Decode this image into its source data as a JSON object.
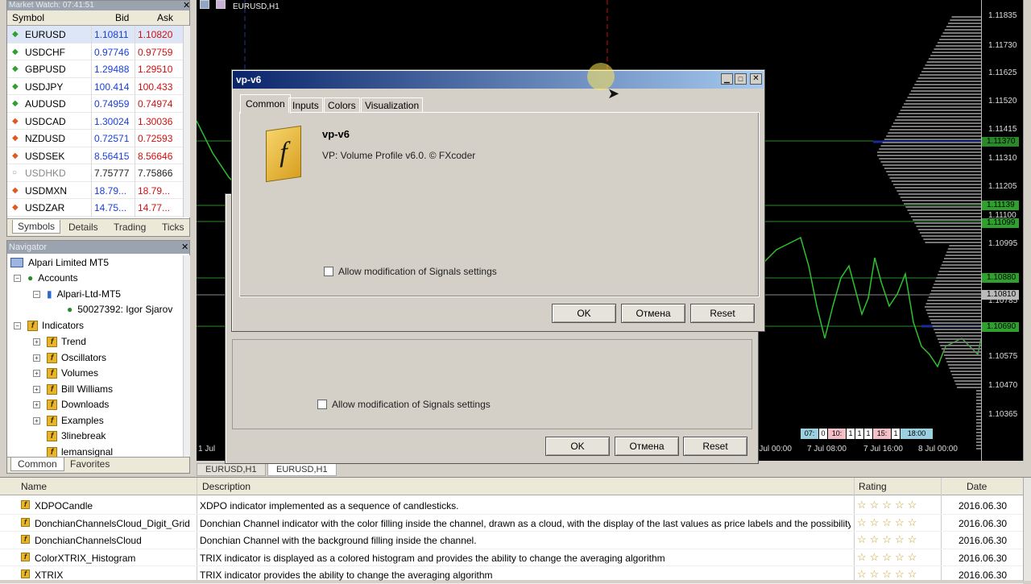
{
  "market_watch": {
    "title": "Market Watch: 07:41:51",
    "col_symbol": "Symbol",
    "col_bid": "Bid",
    "col_ask": "Ask",
    "rows": [
      {
        "symbol": "EURUSD",
        "bid": "1.10811",
        "ask": "1.10820",
        "dir": "up"
      },
      {
        "symbol": "USDCHF",
        "bid": "0.97746",
        "ask": "0.97759",
        "dir": "up"
      },
      {
        "symbol": "GBPUSD",
        "bid": "1.29488",
        "ask": "1.29510",
        "dir": "up"
      },
      {
        "symbol": "USDJPY",
        "bid": "100.414",
        "ask": "100.433",
        "dir": "up"
      },
      {
        "symbol": "AUDUSD",
        "bid": "0.74959",
        "ask": "0.74974",
        "dir": "up"
      },
      {
        "symbol": "USDCAD",
        "bid": "1.30024",
        "ask": "1.30036",
        "dir": "down"
      },
      {
        "symbol": "NZDUSD",
        "bid": "0.72571",
        "ask": "0.72593",
        "dir": "down"
      },
      {
        "symbol": "USDSEK",
        "bid": "8.56415",
        "ask": "8.56646",
        "dir": "down"
      },
      {
        "symbol": "USDHKD",
        "bid": "7.75777",
        "ask": "7.75866",
        "dir": "none"
      },
      {
        "symbol": "USDMXN",
        "bid": "18.79...",
        "ask": "18.79...",
        "dir": "down"
      },
      {
        "symbol": "USDZAR",
        "bid": "14.75...",
        "ask": "14.77...",
        "dir": "down"
      }
    ],
    "tabs": [
      "Symbols",
      "Details",
      "Trading",
      "Ticks"
    ]
  },
  "navigator": {
    "title": "Navigator",
    "broker": "Alpari Limited MT5",
    "accounts": "Accounts",
    "server": "Alpari-Ltd-MT5",
    "account": "50027392: Igor Sjarov",
    "indicators": "Indicators",
    "items": [
      "Trend",
      "Oscillators",
      "Volumes",
      "Bill Williams",
      "Downloads",
      "Examples",
      "3linebreak",
      "lemansignal"
    ],
    "tabs": [
      "Common",
      "Favorites"
    ]
  },
  "chart": {
    "title": "EURUSD,H1",
    "prices": [
      "1.11835",
      "1.11730",
      "1.11625",
      "1.11520",
      "1.11415",
      "1.11310",
      "1.11205",
      "1.11100",
      "1.10995",
      "1.10785",
      "1.10575",
      "1.10470",
      "1.10365"
    ],
    "price_boxes": [
      {
        "label": "1.11370",
        "color": "#2a8a2a"
      },
      {
        "label": "1.11139",
        "color": "#2ea02e"
      },
      {
        "label": "1.11099",
        "color": "#2ea02e"
      },
      {
        "label": "1.10880",
        "color": "#2ea02e"
      },
      {
        "label": "1.10810",
        "color": "#bbbbbb"
      },
      {
        "label": "1.10690",
        "color": "#2ea02e"
      }
    ],
    "time_labels": [
      "1 Jul",
      "7 Jul 00:00",
      "7 Jul 08:00",
      "7 Jul 16:00",
      "8 Jul 00:00"
    ],
    "session_labels": [
      "07:",
      "0",
      "10:",
      "1",
      "1",
      "1",
      "15:",
      "1",
      "18:00"
    ],
    "tabs": [
      "EURUSD,H1",
      "EURUSD,H1"
    ]
  },
  "dialog": {
    "title": "vp-v6",
    "tabs": [
      "Common",
      "Inputs",
      "Colors",
      "Visualization"
    ],
    "name": "vp-v6",
    "description": "VP: Volume Profile v6.0. © FXcoder",
    "checkbox": "Allow modification of Signals settings",
    "ok": "OK",
    "cancel": "Отмена",
    "reset": "Reset"
  },
  "table": {
    "headers": [
      "Name",
      "Description",
      "Rating",
      "Date"
    ],
    "rows": [
      {
        "name": "XDPOCandle",
        "desc": "XDPO indicator implemented as a sequence of candlesticks.",
        "stars": "☆☆☆☆☆",
        "date": "2016.06.30"
      },
      {
        "name": "DonchianChannelsCloud_Digit_Grid",
        "desc": "Donchian Channel indicator with the color filling inside the channel, drawn as a cloud, with the display of the last values as price labels and the possibility t...",
        "stars": "☆☆☆☆☆",
        "date": "2016.06.30"
      },
      {
        "name": "DonchianChannelsCloud",
        "desc": "Donchian Channel with the background filling inside the channel.",
        "stars": "☆☆☆☆☆",
        "date": "2016.06.30"
      },
      {
        "name": "ColorXTRIX_Histogram",
        "desc": "TRIX indicator is displayed as a colored histogram and provides the ability to change the averaging algorithm",
        "stars": "☆☆☆☆☆",
        "date": "2016.06.30"
      },
      {
        "name": "XTRIX",
        "desc": "TRIX indicator provides the ability to change the averaging algorithm",
        "stars": "☆☆☆☆☆",
        "date": "2016.06.30"
      }
    ]
  },
  "colors": {
    "bid": "#1a3fd8",
    "ask": "#d01010",
    "dialog_title": "#0a246a"
  }
}
